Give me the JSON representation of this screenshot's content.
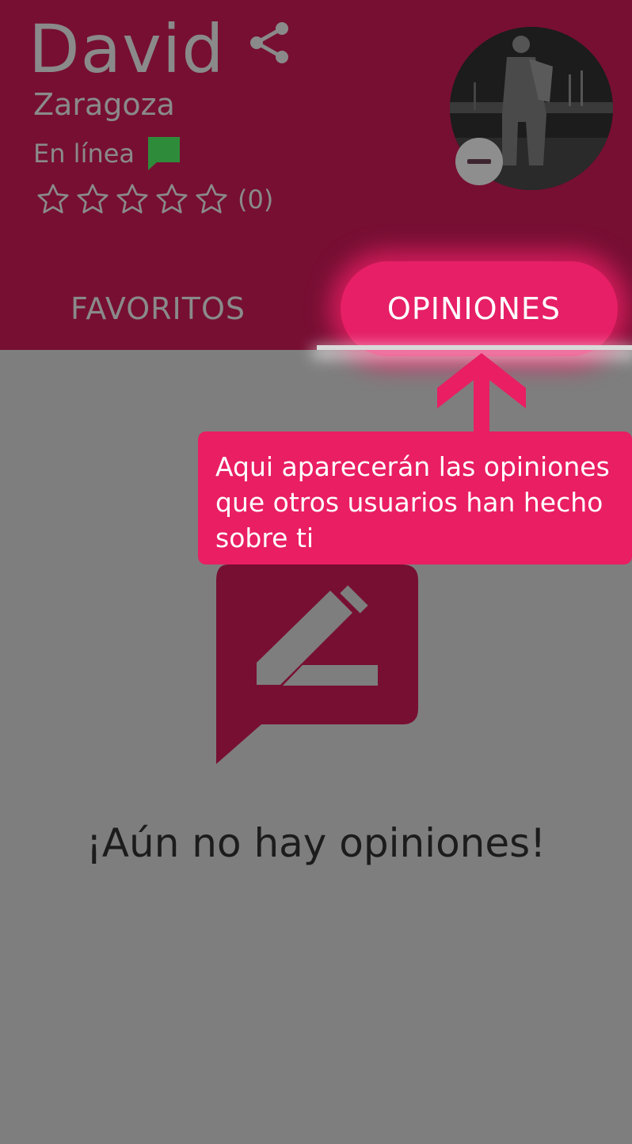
{
  "profile": {
    "name": "David",
    "city": "Zaragoza",
    "status": "En línea",
    "rating_count": "(0)",
    "rating_value": 0,
    "rating_max": 5
  },
  "tabs": [
    {
      "label": "FAVORITOS",
      "selected": false
    },
    {
      "label": "OPINIONES",
      "selected": true
    }
  ],
  "tooltip": {
    "text": "Aqui aparecerán las opiniones que otros usuarios han hecho sobre ti"
  },
  "empty_state": {
    "message": "¡Aún no hay opiniones!",
    "icon": "edit-comment-icon"
  },
  "colors": {
    "header_bg": "#770f33",
    "accent": "#e91e63",
    "online": "#2e8b3a"
  },
  "icons": {
    "share": "share-icon",
    "status": "chat-bubble-icon",
    "star": "star-outline-icon",
    "avatar_badge": "minus-icon",
    "tooltip_arrow": "arrow-up-icon"
  }
}
